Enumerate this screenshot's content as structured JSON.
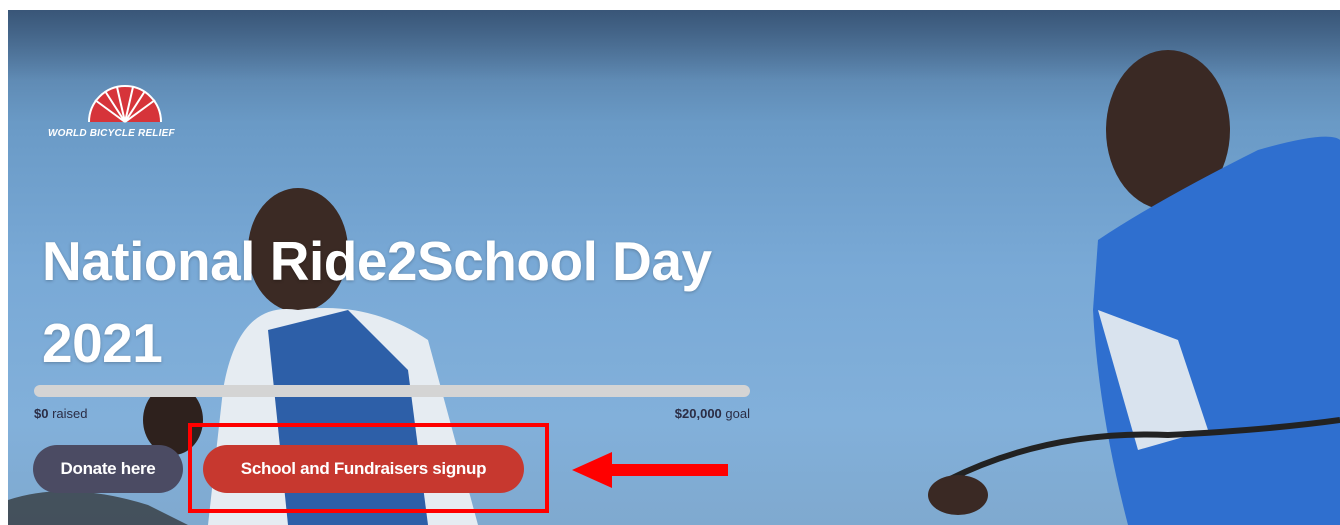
{
  "brand": {
    "name": "WORLD BICYCLE RELIEF"
  },
  "hero": {
    "title_line1": "National Ride2School Day",
    "title_line2": "2021"
  },
  "campaign": {
    "raised_amount": "$0",
    "raised_label": "raised",
    "goal_amount": "$20,000",
    "goal_label": "goal",
    "progress_fraction": 0
  },
  "buttons": {
    "donate_label": "Donate here",
    "signup_label": "School and Fundraisers signup"
  },
  "colors": {
    "accent_red": "#c7382f",
    "donate_gray": "#4b4b63",
    "highlight": "#ff0000"
  }
}
